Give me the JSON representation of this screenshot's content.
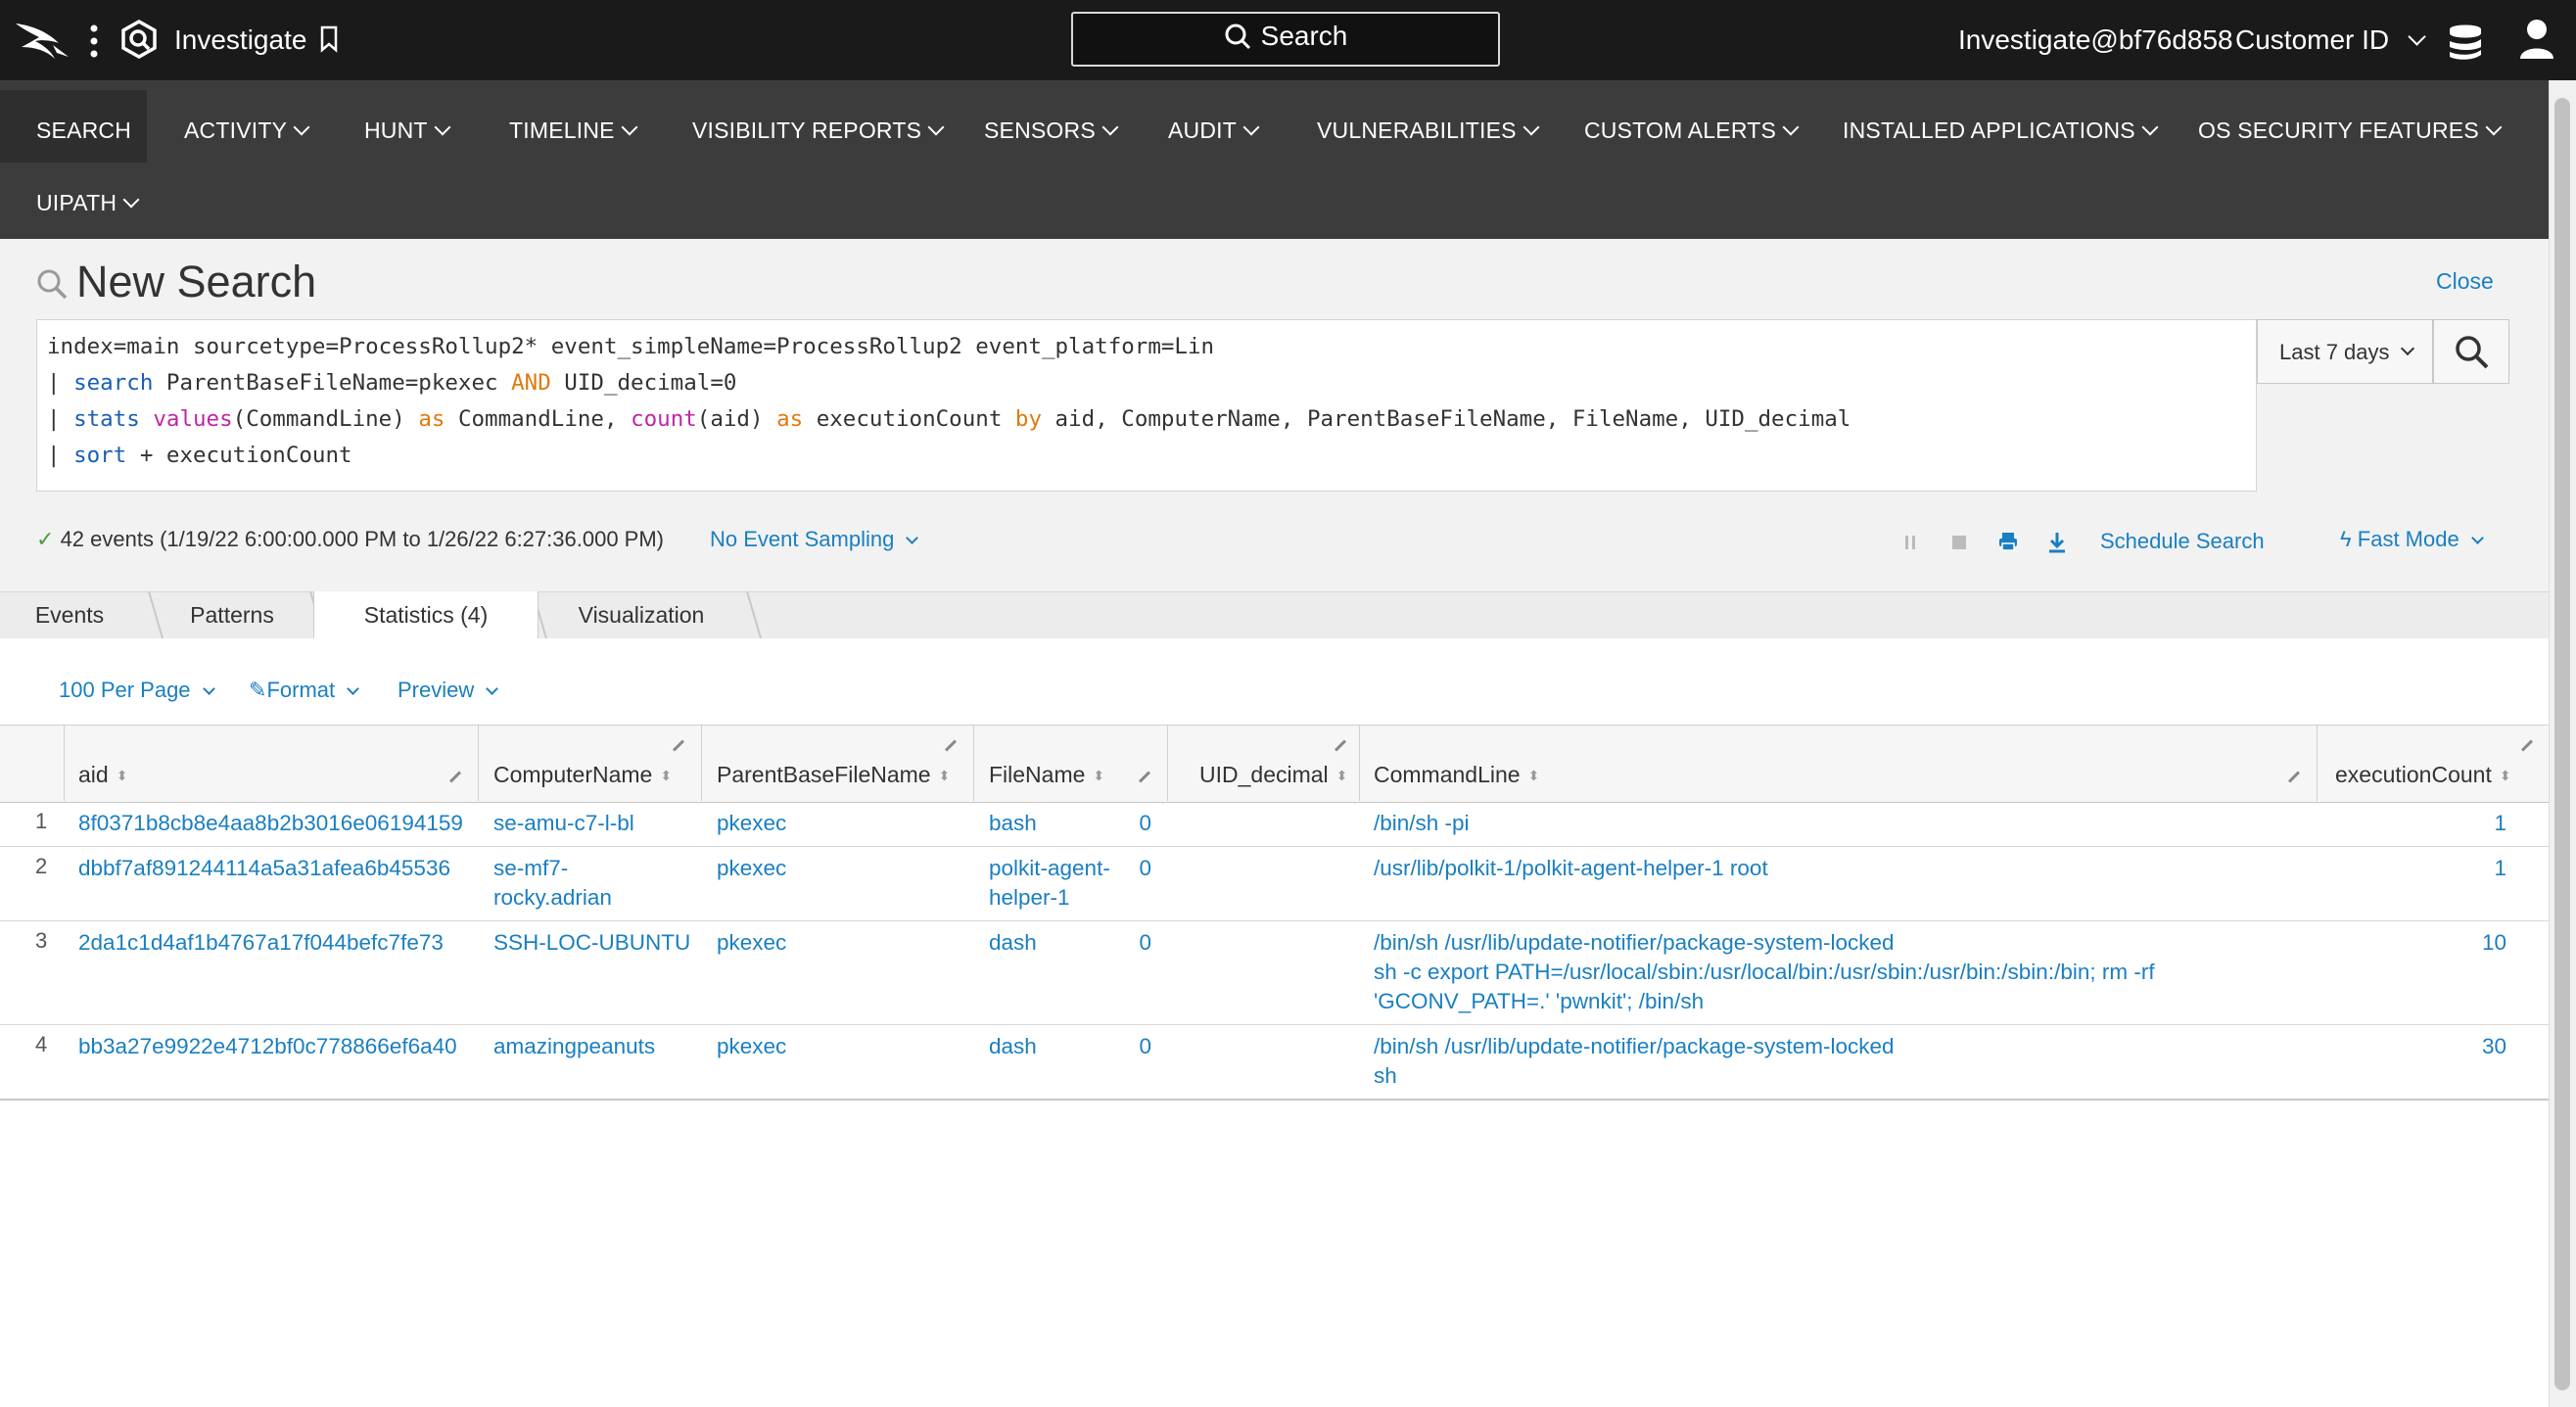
{
  "topbar": {
    "app_name": "Investigate",
    "search_label": "Search",
    "user": "Investigate@bf76d858",
    "customer_id": "Customer ID"
  },
  "nav": {
    "items": [
      "SEARCH",
      "ACTIVITY",
      "HUNT",
      "TIMELINE",
      "VISIBILITY REPORTS",
      "SENSORS",
      "AUDIT",
      "VULNERABILITIES",
      "CUSTOM ALERTS",
      "INSTALLED APPLICATIONS",
      "OS SECURITY FEATURES",
      "UIPATH"
    ]
  },
  "search": {
    "title": "New Search",
    "close": "Close",
    "query": {
      "line1": "index=main sourcetype=ProcessRollup2* event_simpleName=ProcessRollup2 event_platform=Lin",
      "line2_pipe": "| ",
      "line2_cmd": "search",
      "line2_a": " ParentBaseFileName=pkexec ",
      "line2_op": "AND",
      "line2_b": " UID_decimal=0",
      "line3_pipe": "| ",
      "line3_cmd": "stats",
      "line3_f1": "values",
      "line3_a": "(CommandLine) ",
      "line3_as1": "as",
      "line3_b": " CommandLine, ",
      "line3_f2": "count",
      "line3_c": "(aid) ",
      "line3_as2": "as",
      "line3_d": " executionCount ",
      "line3_by": "by",
      "line3_e": " aid, ComputerName, ParentBaseFileName, FileName, UID_decimal",
      "line4_pipe": "| ",
      "line4_cmd": "sort",
      "line4_a": " + executionCount"
    },
    "time_range": "Last 7 days",
    "events_summary": "42 events (1/19/22 6:00:00.000 PM to 1/26/22 6:27:36.000 PM)",
    "sampling": "No Event Sampling",
    "schedule": "Schedule Search",
    "mode": "Fast Mode"
  },
  "tabs": [
    "Events",
    "Patterns",
    "Statistics (4)",
    "Visualization"
  ],
  "table_controls": {
    "per_page": "100 Per Page",
    "format": "Format",
    "preview": "Preview"
  },
  "table": {
    "columns": [
      "aid",
      "ComputerName",
      "ParentBaseFileName",
      "FileName",
      "UID_decimal",
      "CommandLine",
      "executionCount"
    ],
    "rows": [
      {
        "num": "1",
        "aid": "8f0371b8cb8e4aa8b2b3016e06194159",
        "computer": [
          "se-amu-c7-l-bl"
        ],
        "parent": "pkexec",
        "file": [
          "bash"
        ],
        "uid": "0",
        "cmd": [
          "/bin/sh -pi"
        ],
        "count": "1"
      },
      {
        "num": "2",
        "aid": "dbbf7af891244114a5a31afea6b45536",
        "computer": [
          "se-mf7-",
          "rocky.adrian"
        ],
        "parent": "pkexec",
        "file": [
          "polkit-agent-",
          "helper-1"
        ],
        "uid": "0",
        "cmd": [
          "/usr/lib/polkit-1/polkit-agent-helper-1 root"
        ],
        "count": "1"
      },
      {
        "num": "3",
        "aid": "2da1c1d4af1b4767a17f044befc7fe73",
        "computer": [
          "SSH-LOC-UBUNTU"
        ],
        "parent": "pkexec",
        "file": [
          "dash"
        ],
        "uid": "0",
        "cmd": [
          "/bin/sh /usr/lib/update-notifier/package-system-locked",
          "sh -c export PATH=/usr/local/sbin:/usr/local/bin:/usr/sbin:/usr/bin:/sbin:/bin; rm -rf",
          "'GCONV_PATH=.' 'pwnkit'; /bin/sh"
        ],
        "count": "10"
      },
      {
        "num": "4",
        "aid": "bb3a27e9922e4712bf0c778866ef6a40",
        "computer": [
          "amazingpeanuts"
        ],
        "parent": "pkexec",
        "file": [
          "dash"
        ],
        "uid": "0",
        "cmd": [
          "/bin/sh /usr/lib/update-notifier/package-system-locked",
          "sh"
        ],
        "count": "30"
      }
    ]
  }
}
